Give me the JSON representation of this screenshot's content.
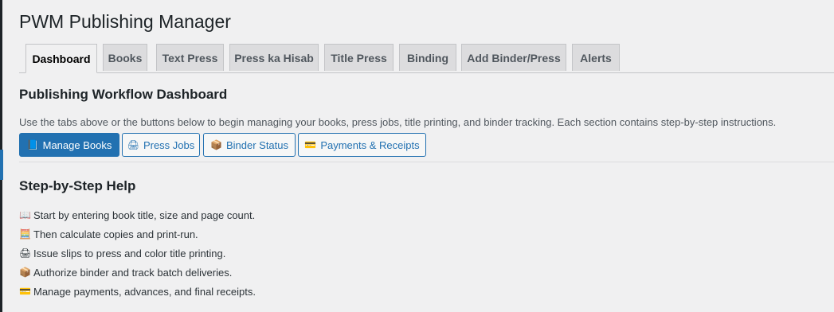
{
  "app": {
    "title": "PWM Publishing Manager"
  },
  "tabs": [
    {
      "label": "Dashboard",
      "active": true
    },
    {
      "label": "Books"
    },
    {
      "label": "Text Press"
    },
    {
      "label": "Press ka Hisab"
    },
    {
      "label": "Title Press"
    },
    {
      "label": "Binding"
    },
    {
      "label": "Add Binder/Press"
    },
    {
      "label": "Alerts"
    }
  ],
  "dashboard": {
    "heading": "Publishing Workflow Dashboard",
    "description": "Use the tabs above or the buttons below to begin managing your books, press jobs, title printing, and binder tracking. Each section contains step-by-step instructions.",
    "buttons": [
      {
        "label": "Manage Books",
        "icon": "📘",
        "icon_name": "book-icon"
      },
      {
        "label": "Press Jobs",
        "icon": "🖨",
        "icon_name": "printer-icon"
      },
      {
        "label": "Binder Status",
        "icon": "📦",
        "icon_name": "package-icon"
      },
      {
        "label": "Payments & Receipts",
        "icon": "💳",
        "icon_name": "credit-card-icon"
      }
    ]
  },
  "help": {
    "heading": "Step-by-Step Help",
    "steps": [
      {
        "icon": "📖",
        "icon_name": "open-book-icon",
        "text": "Start by entering book title, size and page count."
      },
      {
        "icon": "🧮",
        "icon_name": "calculator-icon",
        "text": "Then calculate copies and print-run."
      },
      {
        "icon": "🖨",
        "icon_name": "printer-icon",
        "text": "Issue slips to press and color title printing."
      },
      {
        "icon": "📦",
        "icon_name": "package-icon",
        "text": "Authorize binder and track batch deliveries."
      },
      {
        "icon": "💳",
        "icon_name": "credit-card-icon",
        "text": "Manage payments, advances, and final receipts."
      }
    ]
  },
  "colors": {
    "accent": "#2271b1",
    "background": "#f0f0f1",
    "text": "#1d2327"
  }
}
